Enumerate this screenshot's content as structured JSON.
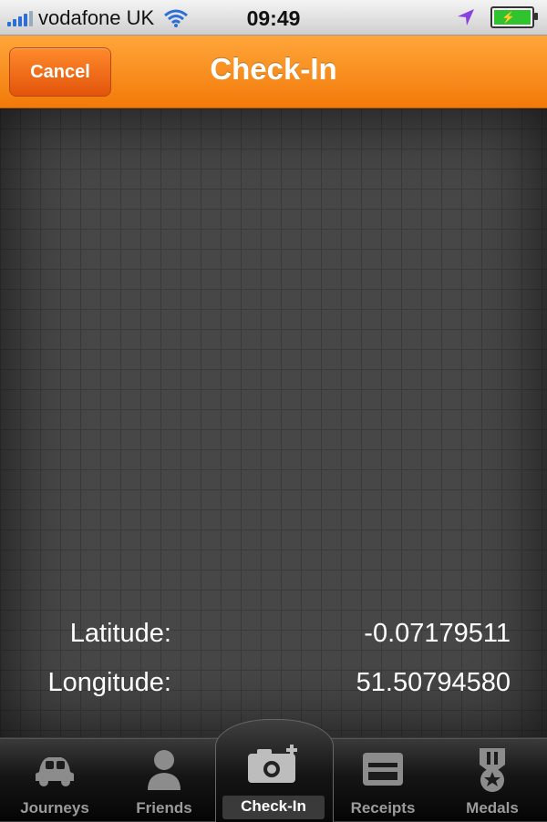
{
  "status_bar": {
    "carrier": "vodafone UK",
    "time": "09:49",
    "icons": [
      "signal-bars-icon",
      "wifi-icon",
      "location-arrow-icon",
      "battery-charging-icon"
    ]
  },
  "nav": {
    "cancel_label": "Cancel",
    "title": "Check-In"
  },
  "location": {
    "latitude_label": "Latitude:",
    "latitude_value": "-0.07179511",
    "longitude_label": "Longitude:",
    "longitude_value": "51.50794580"
  },
  "tabbar": {
    "tabs": [
      {
        "label": "Journeys",
        "icon": "car-icon"
      },
      {
        "label": "Friends",
        "icon": "person-icon"
      },
      {
        "label": "Check-In",
        "icon": "camera-plus-icon",
        "active": true
      },
      {
        "label": "Receipts",
        "icon": "card-icon"
      },
      {
        "label": "Medals",
        "icon": "medal-icon"
      }
    ]
  },
  "colors": {
    "nav_orange": "#f58a16",
    "accent_location": "#8a3fe0"
  }
}
